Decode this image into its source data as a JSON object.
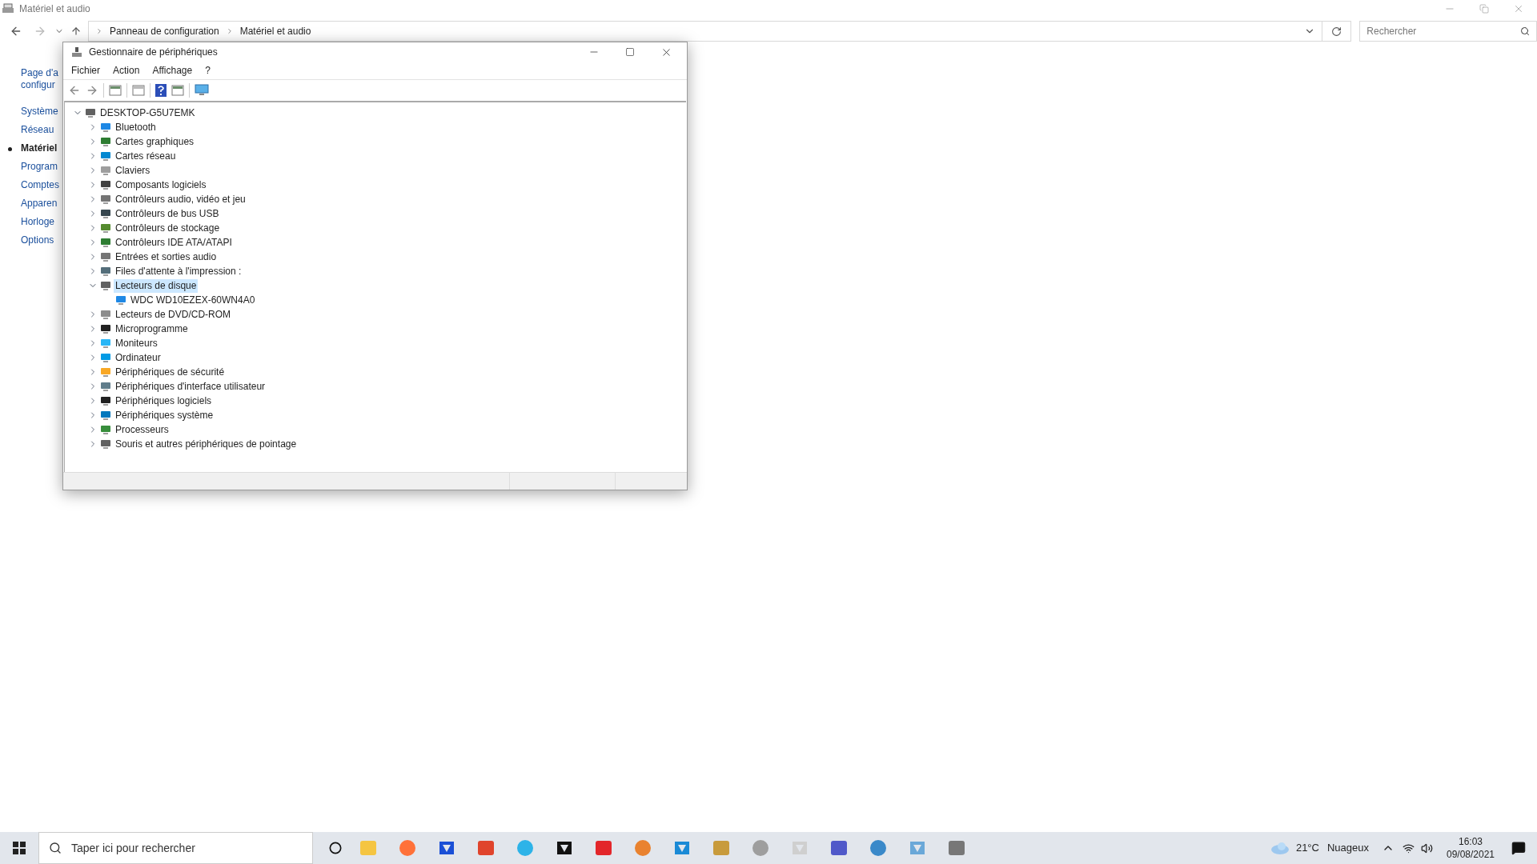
{
  "background_window": {
    "title": "Matériel et audio",
    "address": [
      "Panneau de configuration",
      "Matériel et audio"
    ],
    "search": {
      "placeholder": "Rechercher"
    },
    "sidebar": [
      {
        "label": "Page d'a",
        "selected": false
      },
      {
        "label": "configur",
        "selected": false
      },
      {
        "label": "Système",
        "selected": false
      },
      {
        "label": "Réseau",
        "selected": false
      },
      {
        "label": "Matériel",
        "selected": true
      },
      {
        "label": "Program",
        "selected": false
      },
      {
        "label": "Comptes",
        "selected": false
      },
      {
        "label": "Apparen",
        "selected": false
      },
      {
        "label": "Horloge",
        "selected": false
      },
      {
        "label": "Options",
        "selected": false
      }
    ]
  },
  "dialog": {
    "title": "Gestionnaire de périphériques",
    "menu": [
      "Fichier",
      "Action",
      "Affichage",
      "?"
    ],
    "tree": {
      "label": "DESKTOP-G5U7EMK",
      "expanded": true,
      "selected": false,
      "children": [
        {
          "label": "Bluetooth",
          "expanded": false,
          "selected": false
        },
        {
          "label": "Cartes graphiques",
          "expanded": false,
          "selected": false
        },
        {
          "label": "Cartes réseau",
          "expanded": false,
          "selected": false
        },
        {
          "label": "Claviers",
          "expanded": false,
          "selected": false
        },
        {
          "label": "Composants logiciels",
          "expanded": false,
          "selected": false
        },
        {
          "label": "Contrôleurs audio, vidéo et jeu",
          "expanded": false,
          "selected": false
        },
        {
          "label": "Contrôleurs de bus USB",
          "expanded": false,
          "selected": false
        },
        {
          "label": "Contrôleurs de stockage",
          "expanded": false,
          "selected": false
        },
        {
          "label": "Contrôleurs IDE ATA/ATAPI",
          "expanded": false,
          "selected": false
        },
        {
          "label": "Entrées et sorties audio",
          "expanded": false,
          "selected": false
        },
        {
          "label": "Files d'attente à l'impression :",
          "expanded": false,
          "selected": false
        },
        {
          "label": "Lecteurs de disque",
          "expanded": true,
          "selected": true,
          "children": [
            {
              "label": "WDC WD10EZEX-60WN4A0",
              "selected": false
            }
          ]
        },
        {
          "label": "Lecteurs de DVD/CD-ROM",
          "expanded": false,
          "selected": false
        },
        {
          "label": "Microprogramme",
          "expanded": false,
          "selected": false
        },
        {
          "label": "Moniteurs",
          "expanded": false,
          "selected": false
        },
        {
          "label": "Ordinateur",
          "expanded": false,
          "selected": false
        },
        {
          "label": "Périphériques de sécurité",
          "expanded": false,
          "selected": false
        },
        {
          "label": "Périphériques d'interface utilisateur",
          "expanded": false,
          "selected": false
        },
        {
          "label": "Périphériques logiciels",
          "expanded": false,
          "selected": false
        },
        {
          "label": "Périphériques système",
          "expanded": false,
          "selected": false
        },
        {
          "label": "Processeurs",
          "expanded": false,
          "selected": false
        },
        {
          "label": "Souris et autres périphériques de pointage",
          "expanded": false,
          "selected": false
        }
      ]
    }
  },
  "taskbar": {
    "search": {
      "placeholder": "Taper ici pour rechercher"
    },
    "weather": {
      "temperature": "21°C",
      "condition": "Nuageux"
    },
    "time": "16:03",
    "date": "09/08/2021"
  }
}
